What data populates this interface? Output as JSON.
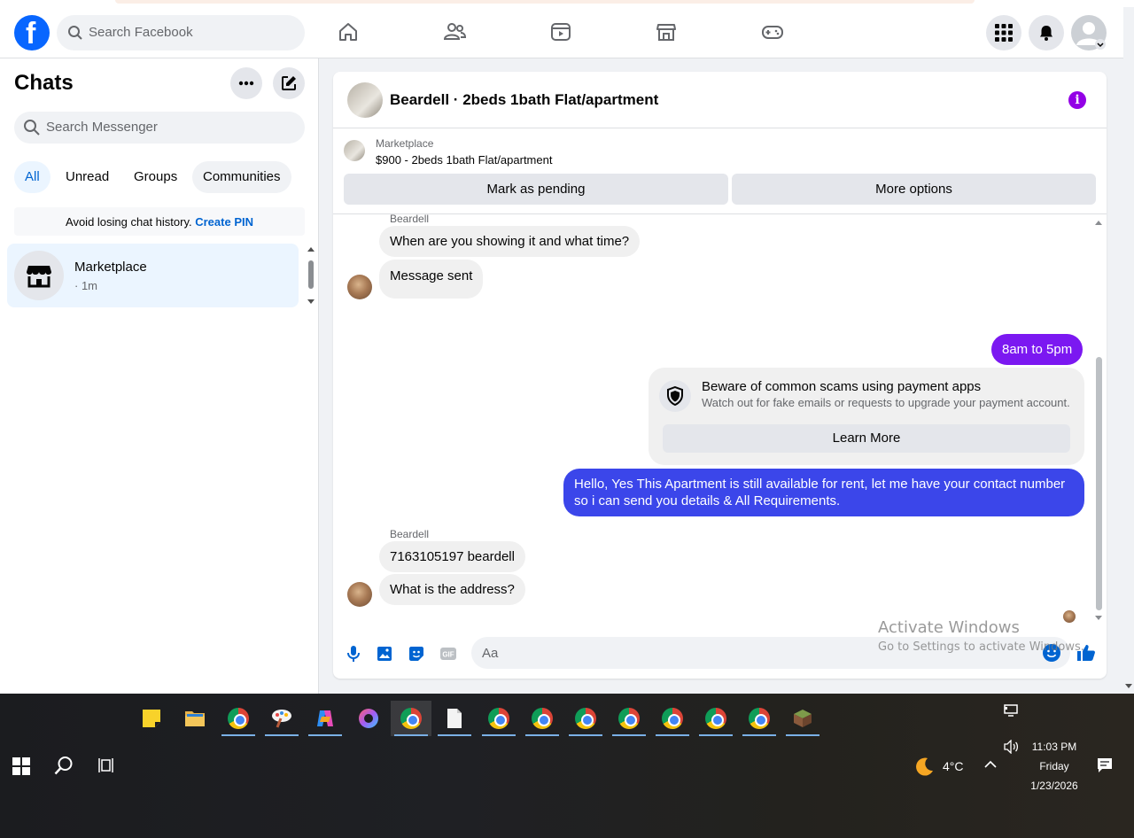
{
  "header": {
    "search_placeholder": "Search Facebook"
  },
  "sidebar": {
    "title": "Chats",
    "search_placeholder": "Search Messenger",
    "filters": [
      "All",
      "Unread",
      "Groups",
      "Communities"
    ],
    "pin_notice": "Avoid losing chat history.",
    "pin_link": "Create PIN",
    "conversations": [
      {
        "name": "Marketplace",
        "time": "· 1m"
      }
    ]
  },
  "chat": {
    "title": "Beardell · 2beds 1bath Flat/apartment",
    "marketplace_label": "Marketplace",
    "listing": "$900 - 2beds 1bath Flat/apartment",
    "mark_pending": "Mark as pending",
    "more_options": "More options",
    "messages": [
      {
        "sender": "Beardell",
        "text": "When are you showing it and what time?"
      },
      {
        "text": "Message sent"
      },
      {
        "text": "8am to 5pm"
      },
      {
        "text": "Hello, Yes This Apartment is still available for rent, let me have your contact number so i can send you details & All Requirements."
      },
      {
        "sender": "Beardell",
        "text": "7163105197 beardell"
      },
      {
        "text": "What is the address?"
      }
    ],
    "scam_title": "Beware of common scams using payment apps",
    "scam_body": "Watch out for fake emails or requests to upgrade your payment account.",
    "learn_more": "Learn More",
    "composer_placeholder": "Aa",
    "colors": {
      "outgoing_top": "#7b18f1",
      "outgoing_bottom": "#3b46ea",
      "accent": "#0064d1"
    }
  },
  "watermark": {
    "line1": "Activate Windows",
    "line2": "Go to Settings to activate Windows."
  },
  "taskbar": {
    "weather": "4°C",
    "time": "11:03 PM",
    "day": "Friday",
    "date": "1/23/2026"
  }
}
